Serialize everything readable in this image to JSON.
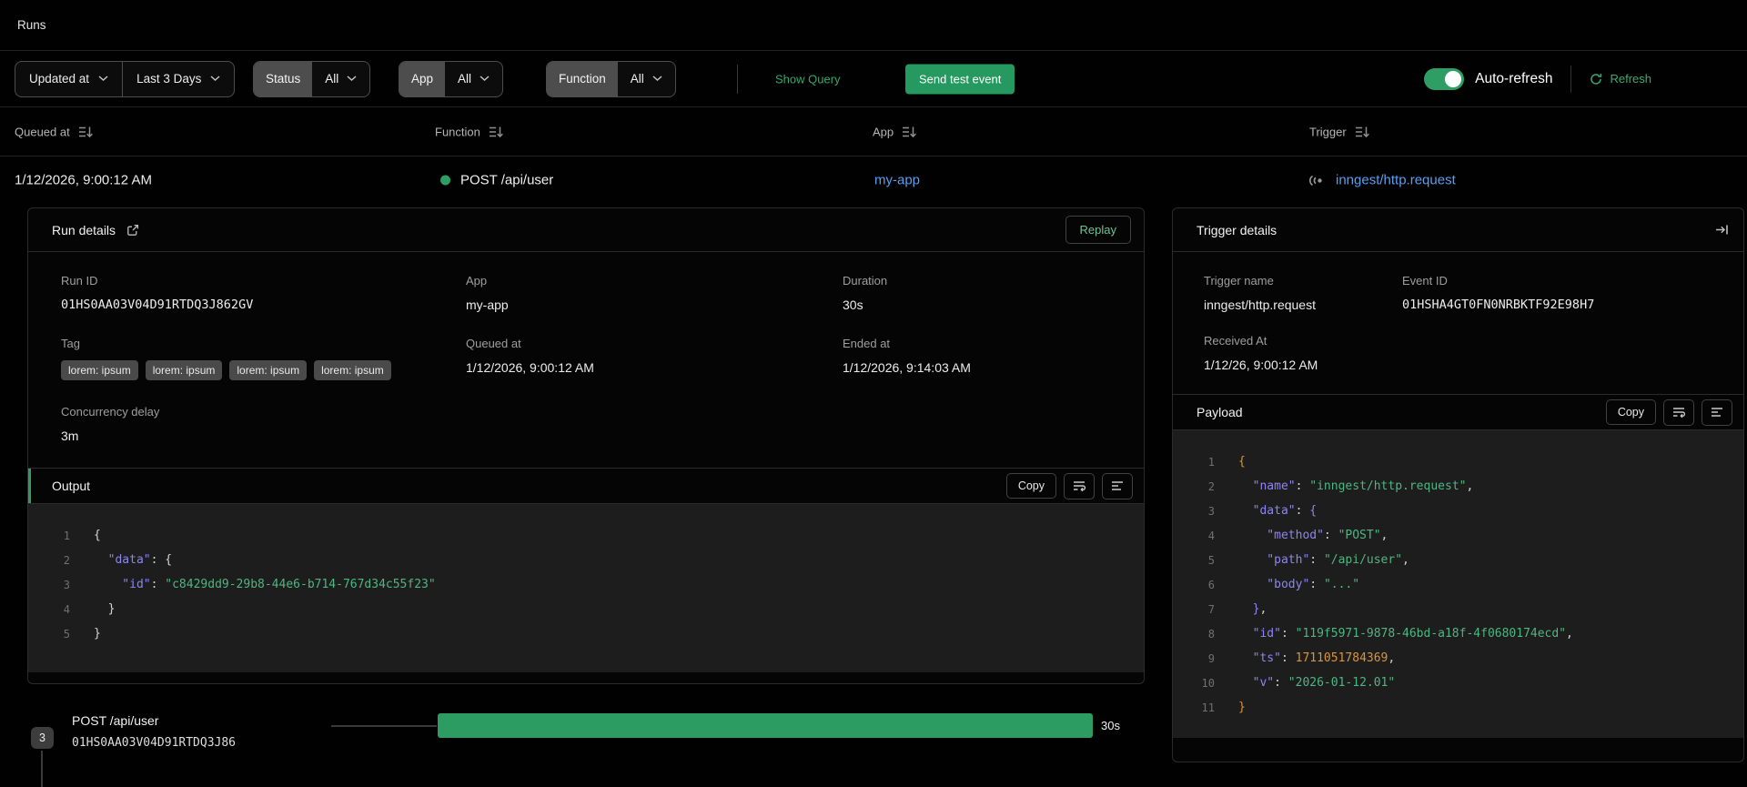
{
  "page": {
    "title": "Runs"
  },
  "filters": {
    "sort_field_label": "Updated at",
    "time_range_label": "Last 3 Days",
    "segmented": [
      {
        "name": "status",
        "label": "Status",
        "value": "All"
      },
      {
        "name": "app",
        "label": "App",
        "value": "All"
      },
      {
        "name": "function",
        "label": "Function",
        "value": "All"
      }
    ],
    "show_query_label": "Show Query",
    "send_test_event_label": "Send test event",
    "auto_refresh_label": "Auto-refresh",
    "auto_refresh_on": true,
    "refresh_label": "Refresh"
  },
  "runs_table": {
    "columns": [
      "Queued at",
      "Function",
      "App",
      "Trigger"
    ],
    "row": {
      "queued_at": "1/12/2026, 9:00:12 AM",
      "function": "POST /api/user",
      "status_color": "#2f9e63",
      "app": "my-app",
      "trigger": "inngest/http.request"
    }
  },
  "run_details": {
    "title": "Run details",
    "replay_label": "Replay",
    "run_id_label": "Run ID",
    "run_id": "01HS0AA03V04D91RTDQ3J862GV",
    "app_label": "App",
    "app": "my-app",
    "duration_label": "Duration",
    "duration": "30s",
    "tag_label": "Tag",
    "tags": [
      "lorem: ipsum",
      "lorem: ipsum",
      "lorem: ipsum",
      "lorem: ipsum"
    ],
    "queued_at_label": "Queued at",
    "queued_at": "1/12/2026, 9:00:12 AM",
    "ended_at_label": "Ended at",
    "ended_at": "1/12/2026, 9:14:03 AM",
    "concurrency_label": "Concurrency delay",
    "concurrency": "3m",
    "output": {
      "title": "Output",
      "copy_label": "Copy",
      "lines": [
        [
          {
            "c": "b",
            "t": "{"
          }
        ],
        [
          {
            "c": "k",
            "t": "  \"data\""
          },
          {
            "c": "p",
            "t": ": "
          },
          {
            "c": "b",
            "t": "{"
          }
        ],
        [
          {
            "c": "k",
            "t": "    \"id\""
          },
          {
            "c": "p",
            "t": ": "
          },
          {
            "c": "s",
            "t": "\"c8429dd9-29b8-44e6-b714-767d34c55f23\""
          }
        ],
        [
          {
            "c": "b",
            "t": "  }"
          }
        ],
        [
          {
            "c": "b",
            "t": "}"
          }
        ]
      ]
    }
  },
  "trigger_details": {
    "title": "Trigger details",
    "trigger_name_label": "Trigger name",
    "trigger_name": "inngest/http.request",
    "event_id_label": "Event ID",
    "event_id": "01HSHA4GT0FN0NRBKTF92E98H7",
    "received_at_label": "Received At",
    "received_at": "1/12/26, 9:00:12 AM",
    "payload": {
      "title": "Payload",
      "copy_label": "Copy",
      "lines": [
        [
          {
            "c": "bo",
            "t": "{"
          }
        ],
        [
          {
            "c": "k",
            "t": "  \"name\""
          },
          {
            "c": "p",
            "t": ": "
          },
          {
            "c": "s",
            "t": "\"inngest/http.request\""
          },
          {
            "c": "p",
            "t": ","
          }
        ],
        [
          {
            "c": "k",
            "t": "  \"data\""
          },
          {
            "c": "p",
            "t": ": "
          },
          {
            "c": "bp",
            "t": "{"
          }
        ],
        [
          {
            "c": "k",
            "t": "    \"method\""
          },
          {
            "c": "p",
            "t": ": "
          },
          {
            "c": "s",
            "t": "\"POST\""
          },
          {
            "c": "p",
            "t": ","
          }
        ],
        [
          {
            "c": "k",
            "t": "    \"path\""
          },
          {
            "c": "p",
            "t": ": "
          },
          {
            "c": "s",
            "t": "\"/api/user\""
          },
          {
            "c": "p",
            "t": ","
          }
        ],
        [
          {
            "c": "k",
            "t": "    \"body\""
          },
          {
            "c": "p",
            "t": ": "
          },
          {
            "c": "s",
            "t": "\"...\""
          }
        ],
        [
          {
            "c": "bp",
            "t": "  }"
          },
          {
            "c": "p",
            "t": ","
          }
        ],
        [
          {
            "c": "k",
            "t": "  \"id\""
          },
          {
            "c": "p",
            "t": ": "
          },
          {
            "c": "s",
            "t": "\"119f5971-9878-46bd-a18f-4f0680174ecd\""
          },
          {
            "c": "p",
            "t": ","
          }
        ],
        [
          {
            "c": "k",
            "t": "  \"ts\""
          },
          {
            "c": "p",
            "t": ": "
          },
          {
            "c": "n",
            "t": "1711051784369"
          },
          {
            "c": "p",
            "t": ","
          }
        ],
        [
          {
            "c": "k",
            "t": "  \"v\""
          },
          {
            "c": "p",
            "t": ": "
          },
          {
            "c": "s",
            "t": "\"2026-01-12.01\""
          }
        ],
        [
          {
            "c": "bo",
            "t": "}"
          }
        ]
      ]
    }
  },
  "timeline": {
    "count_badge": "3",
    "step_name": "POST /api/user",
    "step_run_id": "01HS0AA03V04D91RTDQ3J86",
    "duration": "30s",
    "bar_color": "#2d9c63"
  },
  "colors": {
    "accent_green": "#2f9e64",
    "link_blue": "#5a9ff0",
    "link_green": "#40a777"
  }
}
